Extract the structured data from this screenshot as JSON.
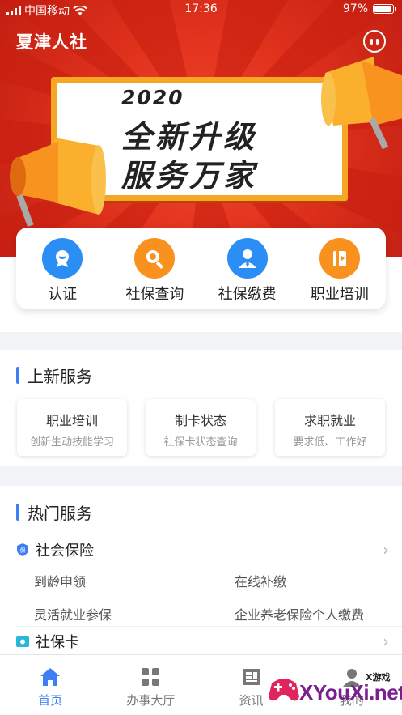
{
  "status_bar": {
    "carrier": "中国移动",
    "time": "17:36",
    "battery": "97%"
  },
  "header": {
    "title": "夏津人社"
  },
  "banner": {
    "year": "2020",
    "line1": "全新升级",
    "line2": "服务万家"
  },
  "quick_actions": [
    {
      "label": "认证",
      "icon": "certification-icon",
      "color": "#2a8ef4"
    },
    {
      "label": "社保查询",
      "icon": "search-icon",
      "color": "#f8911d"
    },
    {
      "label": "社保缴费",
      "icon": "person-payment-icon",
      "color": "#2a8ef4"
    },
    {
      "label": "职业培训",
      "icon": "training-book-icon",
      "color": "#f8911d"
    }
  ],
  "new_services": {
    "title": "上新服务",
    "cards": [
      {
        "title": "职业培训",
        "subtitle": "创新生动技能学习"
      },
      {
        "title": "制卡状态",
        "subtitle": "社保卡状态查询"
      },
      {
        "title": "求职就业",
        "subtitle": "要求低、工作好"
      }
    ]
  },
  "hot_services": {
    "title": "热门服务",
    "groups": [
      {
        "title": "社会保险",
        "icon": "shield-icon",
        "items": [
          "到龄申领",
          "在线补缴",
          "灵活就业参保",
          "企业养老保险个人缴费"
        ]
      },
      {
        "title": "社保卡",
        "icon": "card-icon",
        "items": []
      }
    ]
  },
  "tab_bar": [
    {
      "label": "首页",
      "icon": "home-icon",
      "active": true
    },
    {
      "label": "办事大厅",
      "icon": "grid-icon",
      "active": false
    },
    {
      "label": "资讯",
      "icon": "news-icon",
      "active": false
    },
    {
      "label": "我的",
      "icon": "profile-icon",
      "active": false
    }
  ],
  "watermark": {
    "site": "XYouXi.net",
    "label": "X游戏"
  },
  "colors": {
    "accent": "#3d7ef5",
    "banner_red": "#e0321d",
    "orange": "#f8911d",
    "blue": "#2a8ef4"
  }
}
